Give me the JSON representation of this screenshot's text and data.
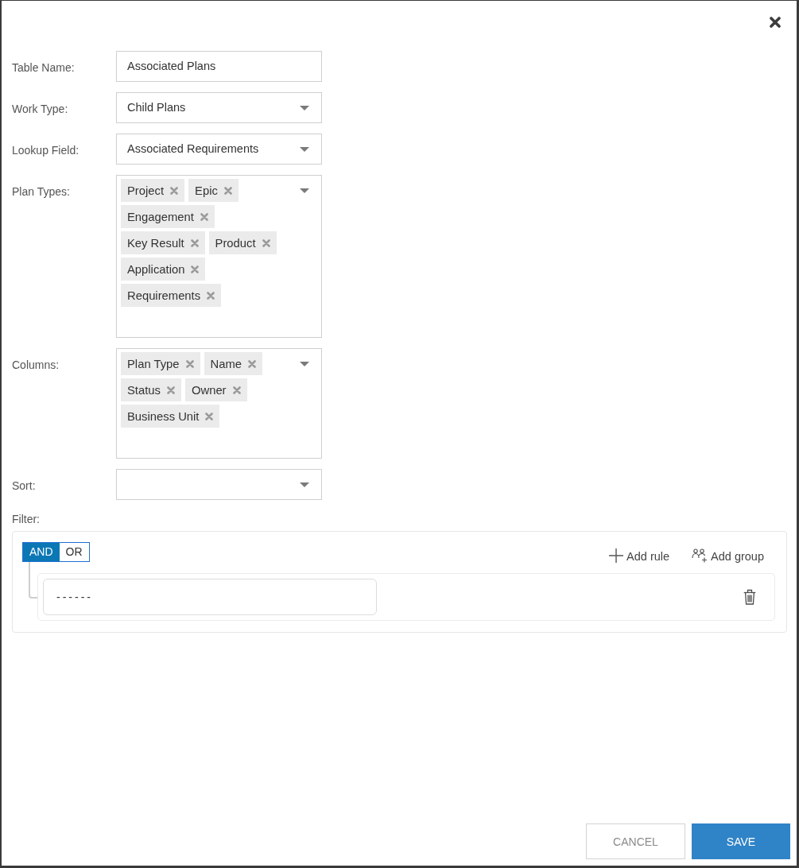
{
  "fields": [
    {
      "kind": "text",
      "label": "Table Name:",
      "value": "Associated Plans"
    },
    {
      "kind": "select",
      "label": "Work Type:",
      "value": "Child Plans"
    },
    {
      "kind": "select",
      "label": "Lookup Field:",
      "value": "Associated Requirements"
    },
    {
      "kind": "multiselect",
      "label": "Plan Types:",
      "tags": [
        "Project",
        "Epic",
        "Engagement",
        "Key Result",
        "Product",
        "Application",
        "Requirements"
      ]
    },
    {
      "kind": "multiselect",
      "label": "Columns:",
      "tags": [
        "Plan Type",
        "Name",
        "Status",
        "Owner",
        "Business Unit"
      ]
    },
    {
      "kind": "select",
      "label": "Sort:"
    }
  ],
  "filter": {
    "label": "Filter:",
    "conditions": [
      {
        "label": "AND",
        "selected": true
      },
      {
        "label": "OR",
        "selected": false
      }
    ],
    "actions": [
      {
        "kind": "add-rule",
        "label": "Add rule"
      },
      {
        "kind": "add-group",
        "label": "Add group"
      }
    ],
    "rules": [
      {
        "value": "------"
      }
    ]
  },
  "buttons": [
    {
      "kind": "cancel",
      "label": "CANCEL"
    },
    {
      "kind": "save",
      "label": "SAVE"
    }
  ]
}
